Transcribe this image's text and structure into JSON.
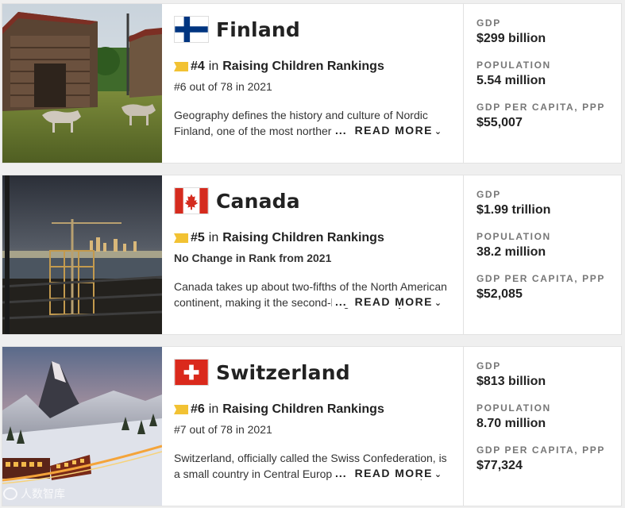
{
  "cards": [
    {
      "country": "Finland",
      "rank": "#4",
      "rank_in": "in",
      "category": "Raising Children Rankings",
      "rank_sub": "#6 out of 78 in 2021",
      "description": "Geography defines the history and culture of Nordic Finland, one of the most northern nations in the world.",
      "dots": "...",
      "read_more": "READ MORE",
      "gdp_label": "GDP",
      "gdp": "$299 billion",
      "population_label": "POPULATION",
      "population": "5.54 million",
      "gdp_pc_label": "GDP PER CAPITA, PPP",
      "gdp_pc": "$55,007",
      "flag": "finland-flag"
    },
    {
      "country": "Canada",
      "rank": "#5",
      "rank_in": "in",
      "category": "Raising Children Rankings",
      "rank_sub": "No Change in Rank from 2021",
      "description": "Canada takes up about two-fifths of the North American continent, making it the second-largest country in the world.",
      "dots": "...",
      "read_more": "READ MORE",
      "gdp_label": "GDP",
      "gdp": "$1.99 trillion",
      "population_label": "POPULATION",
      "population": "38.2 million",
      "gdp_pc_label": "GDP PER CAPITA, PPP",
      "gdp_pc": "$52,085",
      "flag": "canada-flag"
    },
    {
      "country": "Switzerland",
      "rank": "#6",
      "rank_in": "in",
      "category": "Raising Children Rankings",
      "rank_sub": "#7 out of 78 in 2021",
      "description": "Switzerland, officially called the Swiss Confederation, is a small country in Central Europe nestled in the Alps.",
      "dots": "...",
      "read_more": "READ MORE",
      "gdp_label": "GDP",
      "gdp": "$813 billion",
      "population_label": "POPULATION",
      "population": "8.70 million",
      "gdp_pc_label": "GDP PER CAPITA, PPP",
      "gdp_pc": "$77,324",
      "flag": "switzerland-flag"
    }
  ],
  "watermark": "人数智库",
  "colors": {
    "ribbon": "#f2c233",
    "finland_blue": "#003580",
    "canada_red": "#d52b1e",
    "swiss_red": "#da291c"
  }
}
